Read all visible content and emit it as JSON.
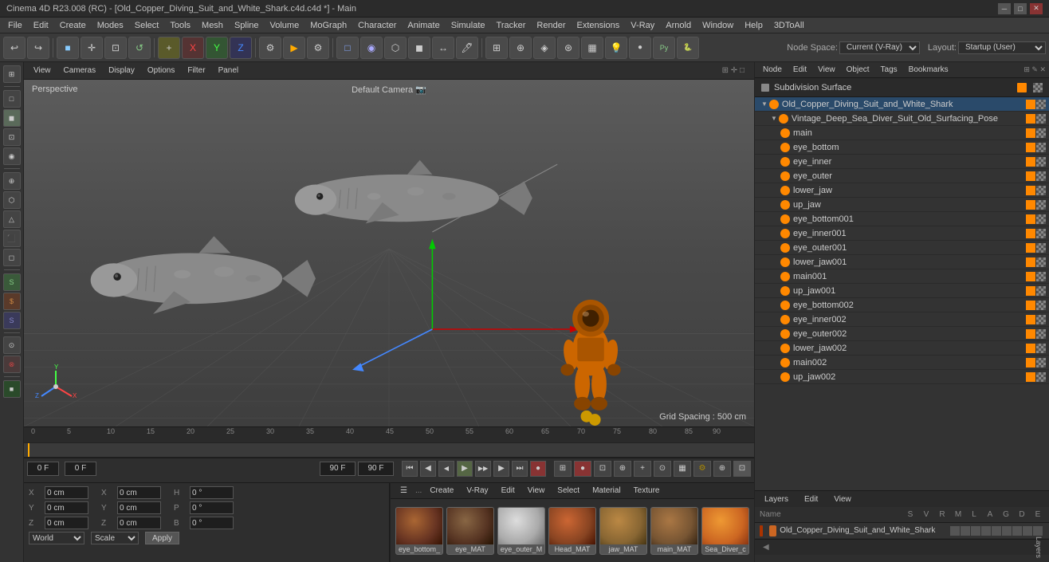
{
  "titleBar": {
    "title": "Cinema 4D R23.008 (RC) - [Old_Copper_Diving_Suit_and_White_Shark.c4d.c4d *] - Main",
    "controls": [
      "─",
      "□",
      "✕"
    ]
  },
  "menuBar": {
    "items": [
      "File",
      "Edit",
      "Create",
      "Modes",
      "Select",
      "Tools",
      "Mesh",
      "Spline",
      "Volume",
      "MoGraph",
      "Character",
      "Animate",
      "Simulate",
      "Tracker",
      "Render",
      "Extensions",
      "V-Ray",
      "Arnold",
      "Window",
      "Help",
      "3DToAll"
    ]
  },
  "nodeSpace": {
    "label": "Node Space:",
    "value": "Current (V-Ray)"
  },
  "layoutLabel": {
    "label": "Layout:",
    "value": "Startup (User)"
  },
  "rightTopMenu": {
    "items": [
      "Node",
      "Edit",
      "View",
      "Object",
      "Tags",
      "Bookmarks"
    ]
  },
  "objectManagerHeader": {
    "topItem": "Subdivision Surface"
  },
  "sceneTree": {
    "items": [
      {
        "name": "Old_Copper_Diving_Suit_and_White_Shark",
        "indent": 0,
        "type": "object",
        "expanded": true
      },
      {
        "name": "Vintage_Deep_Sea_Diver_Suit_Old_Surfacing_Pose",
        "indent": 1,
        "type": "object",
        "expanded": true
      },
      {
        "name": "main",
        "indent": 2,
        "type": "mesh"
      },
      {
        "name": "eye_bottom",
        "indent": 2,
        "type": "mesh"
      },
      {
        "name": "eye_inner",
        "indent": 2,
        "type": "mesh"
      },
      {
        "name": "eye_outer",
        "indent": 2,
        "type": "mesh"
      },
      {
        "name": "lower_jaw",
        "indent": 2,
        "type": "mesh"
      },
      {
        "name": "up_jaw",
        "indent": 2,
        "type": "mesh"
      },
      {
        "name": "eye_bottom001",
        "indent": 2,
        "type": "mesh"
      },
      {
        "name": "eye_inner001",
        "indent": 2,
        "type": "mesh"
      },
      {
        "name": "eye_outer001",
        "indent": 2,
        "type": "mesh"
      },
      {
        "name": "lower_jaw001",
        "indent": 2,
        "type": "mesh"
      },
      {
        "name": "main001",
        "indent": 2,
        "type": "mesh"
      },
      {
        "name": "up_jaw001",
        "indent": 2,
        "type": "mesh"
      },
      {
        "name": "eye_bottom002",
        "indent": 2,
        "type": "mesh"
      },
      {
        "name": "eye_inner002",
        "indent": 2,
        "type": "mesh"
      },
      {
        "name": "eye_outer002",
        "indent": 2,
        "type": "mesh"
      },
      {
        "name": "lower_jaw002",
        "indent": 2,
        "type": "mesh"
      },
      {
        "name": "main002",
        "indent": 2,
        "type": "mesh"
      },
      {
        "name": "up_jaw002",
        "indent": 2,
        "type": "mesh"
      }
    ]
  },
  "viewport": {
    "cameraLabel": "Default Camera",
    "perspectiveLabel": "Perspective",
    "gridSpacing": "Grid Spacing : 500 cm",
    "viewToolbar": [
      "View",
      "Cameras",
      "Display",
      "Options",
      "Filter",
      "Panel"
    ]
  },
  "timeline": {
    "markers": [
      "0",
      "5",
      "10",
      "15",
      "20",
      "25",
      "30",
      "35",
      "40",
      "45",
      "50",
      "55",
      "60",
      "65",
      "70",
      "75",
      "80",
      "85",
      "90"
    ],
    "currentFrame": "0 F",
    "startFrame": "0 F",
    "endFrame": "90 F",
    "previewStart": "0 F",
    "previewEnd": "90 F"
  },
  "materials": {
    "toolbarItems": [
      "Create",
      "V-Ray",
      "Edit",
      "View",
      "Select",
      "Material",
      "Texture"
    ],
    "items": [
      {
        "name": "eye_bottom_",
        "color": "#884422"
      },
      {
        "name": "eye_MAT",
        "color": "#663311"
      },
      {
        "name": "eye_outer_M",
        "color": "#cccccc"
      },
      {
        "name": "Head_MAT",
        "color": "#aa4422"
      },
      {
        "name": "jaw_MAT",
        "color": "#996633"
      },
      {
        "name": "main_MAT",
        "color": "#885533"
      },
      {
        "name": "Sea_Diver_c",
        "color": "#cc7733"
      }
    ]
  },
  "coordinates": {
    "position": {
      "x": "0 cm",
      "y": "0 cm",
      "z": "0 cm"
    },
    "rotation": {
      "x": "0 cm",
      "y": "0 cm",
      "z": "0 cm"
    },
    "scale": {
      "h": "0 °",
      "p": "0 °",
      "b": "0 °"
    },
    "worldLabel": "World",
    "scaleLabel": "Scale",
    "applyBtn": "Apply"
  },
  "layers": {
    "toolbarItems": [
      "Layers",
      "Edit",
      "View"
    ],
    "columnHeaders": [
      "Name",
      "S",
      "V",
      "R",
      "M",
      "L",
      "A",
      "G",
      "D",
      "E"
    ],
    "items": [
      {
        "name": "Old_Copper_Diving_Suit_and_White_Shark",
        "color": "#cc6622"
      }
    ]
  },
  "icons": {
    "undo": "↩",
    "redo": "↪",
    "move": "✛",
    "rotate": "↺",
    "scale": "⤢",
    "select": "↖",
    "liveSelect": "⊕",
    "playback": {
      "first": "⏮",
      "prev": "◀",
      "play": "▶",
      "next": "▶▶",
      "last": "⏭",
      "record": "●"
    }
  }
}
